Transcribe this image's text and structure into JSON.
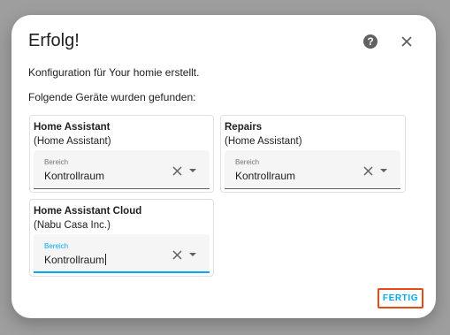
{
  "dialog": {
    "title": "Erfolg!",
    "help_icon": "help-circle-icon",
    "close_icon": "close-icon",
    "config_text": "Konfiguration für Your homie erstellt.",
    "found_text": "Folgende Geräte wurden gefunden:",
    "finish_label": "FERTIG"
  },
  "devices": [
    {
      "name": "Home Assistant",
      "manufacturer": "(Home Assistant)",
      "area_label": "Bereich",
      "area_value": "Kontrollraum"
    },
    {
      "name": "Repairs",
      "manufacturer": "(Home Assistant)",
      "area_label": "Bereich",
      "area_value": "Kontrollraum"
    },
    {
      "name": "Home Assistant Cloud",
      "manufacturer": "(Nabu Casa Inc.)",
      "area_label": "Bereich",
      "area_value": "Kontrollraum"
    }
  ],
  "colors": {
    "accent": "#03a9f4",
    "highlight_border": "#e64a19",
    "overlay": "#9e9e9e"
  }
}
